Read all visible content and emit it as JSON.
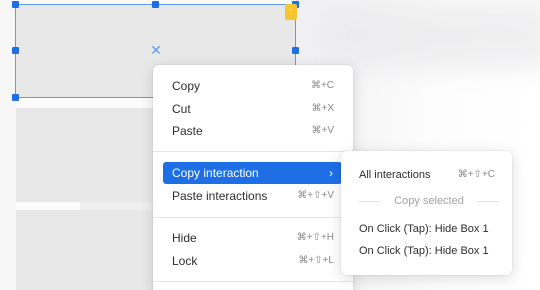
{
  "context_menu": {
    "items": [
      {
        "label": "Copy",
        "shortcut": "⌘+C"
      },
      {
        "label": "Cut",
        "shortcut": "⌘+X"
      },
      {
        "label": "Paste",
        "shortcut": "⌘+V"
      },
      {
        "label": "Copy interaction",
        "shortcut": "›",
        "active": true
      },
      {
        "label": "Paste interactions",
        "shortcut": "⌘+⇧+V"
      },
      {
        "label": "Hide",
        "shortcut": "⌘+⇧+H"
      },
      {
        "label": "Lock",
        "shortcut": "⌘+⇧+L"
      }
    ]
  },
  "submenu": {
    "all": {
      "label": "All interactions",
      "shortcut": "⌘+⇧+C"
    },
    "heading": "Copy selected",
    "items": [
      {
        "label": "On Click (Tap): Hide Box 1"
      },
      {
        "label": "On Click (Tap): Hide Box 1"
      }
    ]
  },
  "canvas": {
    "selection_color": "#1e6fe6",
    "interaction_badge": "lightning-icon",
    "accent": "#f4c534"
  }
}
